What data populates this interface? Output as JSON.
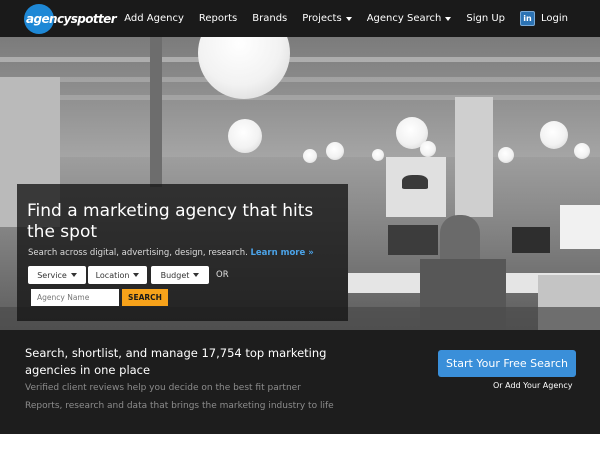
{
  "brand": {
    "logo_text": "agencyspotter",
    "accent": "#1e88d6"
  },
  "nav": {
    "items": [
      {
        "label": "Add Agency"
      },
      {
        "label": "Reports"
      },
      {
        "label": "Brands"
      },
      {
        "label": "Projects"
      },
      {
        "label": "Agency Search"
      },
      {
        "label": "Sign Up"
      }
    ],
    "login_label": "Login",
    "linkedin_glyph": "in"
  },
  "hero": {
    "title": "Find a marketing agency that hits the spot",
    "subtitle": "Search across digital, advertising, design, research.",
    "learn_more": "Learn more »",
    "filters": [
      {
        "label": "Service"
      },
      {
        "label": "Location"
      },
      {
        "label": "Budget"
      }
    ],
    "or_label": "OR",
    "name_placeholder": "Agency Name",
    "search_label": "SEARCH",
    "search_color": "#f7a21a"
  },
  "band": {
    "headline": "Search, shortlist, and manage 17,754 top marketing agencies in one place",
    "line1": "Verified client reviews help you decide on the best fit partner",
    "line2": "Reports, research and data that brings the marketing industry to life",
    "cta_label": "Start Your Free Search",
    "cta_color": "#3a8fd9",
    "secondary_link": "Or Add Your Agency"
  }
}
